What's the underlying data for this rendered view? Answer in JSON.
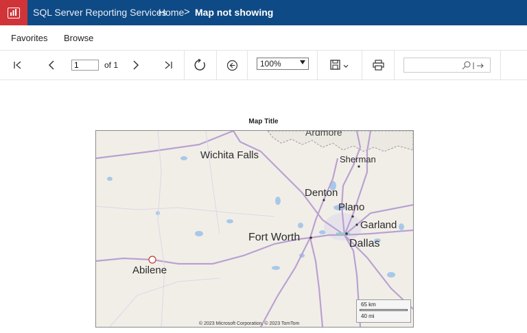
{
  "header": {
    "app_title": "SQL Server Reporting Services",
    "breadcrumb_home": "Home",
    "breadcrumb_sep": ">",
    "breadcrumb_current": "Map not showing"
  },
  "nav": {
    "favorites": "Favorites",
    "browse": "Browse"
  },
  "toolbar": {
    "page_value": "1",
    "of_label": "of 1",
    "zoom_value": "100%",
    "zoom_options": [
      "100%"
    ]
  },
  "report": {
    "map_title": "Map Title",
    "cities": {
      "ardmore": "Ardmore",
      "wichita_falls": "Wichita Falls",
      "sherman": "Sherman",
      "denton": "Denton",
      "plano": "Plano",
      "garland": "Garland",
      "fort_worth": "Fort Worth",
      "dallas": "Dallas",
      "abilene": "Abilene"
    },
    "scale_km": "65 km",
    "scale_mi": "40 mi",
    "copyright": "© 2023 Microsoft Corporation, © 2023 TomTom"
  },
  "colors": {
    "header_bg": "#0e4a85",
    "logo_bg": "#d13438"
  }
}
